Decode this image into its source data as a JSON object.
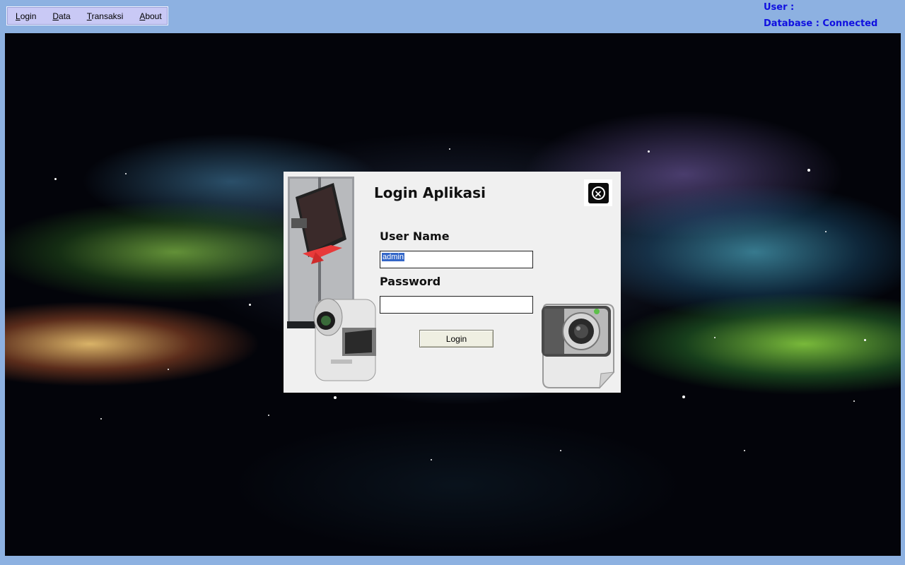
{
  "menu": {
    "items": [
      {
        "label": "Login",
        "accel": "L"
      },
      {
        "label": "Data",
        "accel": "D"
      },
      {
        "label": "Transaksi",
        "accel": "T"
      },
      {
        "label": "About",
        "accel": "A"
      }
    ]
  },
  "status": {
    "user": "User :",
    "database": "Database : Connected"
  },
  "dialog": {
    "title": "Login Aplikasi",
    "username_label": "User Name",
    "username_value": "admin",
    "password_label": "Password",
    "password_value": "",
    "login_button": "Login"
  },
  "colors": {
    "status_text": "#1010e0",
    "desktop_bg": "#8db1e1",
    "menu_bg": "#c9c9f5"
  }
}
